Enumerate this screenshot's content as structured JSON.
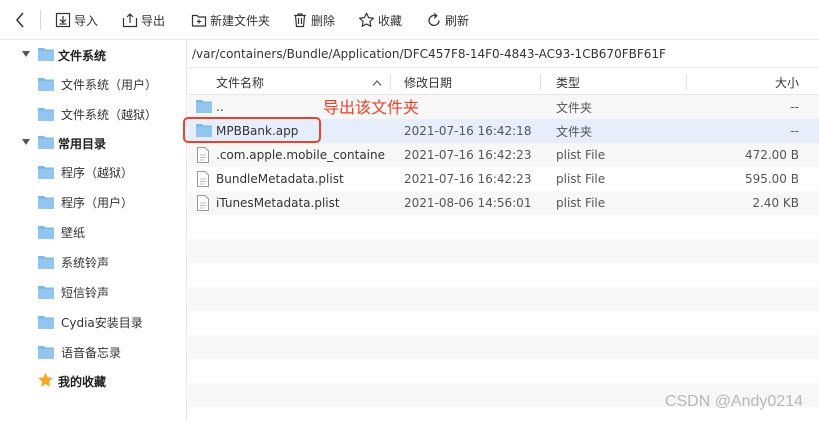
{
  "toolbar": {
    "back_icon": "chevron-left-icon",
    "buttons": [
      {
        "label": "导入",
        "icon": "import-icon"
      },
      {
        "label": "导出",
        "icon": "export-icon"
      },
      {
        "label": "新建文件夹",
        "icon": "new-folder-icon"
      },
      {
        "label": "删除",
        "icon": "trash-icon"
      },
      {
        "label": "收藏",
        "icon": "star-icon"
      },
      {
        "label": "刷新",
        "icon": "refresh-icon"
      }
    ]
  },
  "sidebar": {
    "groups": [
      {
        "label": "文件系统",
        "items": [
          "文件系统（用户）",
          "文件系统（越狱）"
        ]
      },
      {
        "label": "常用目录",
        "items": [
          "程序（越狱）",
          "程序（用户）",
          "壁纸",
          "系统铃声",
          "短信铃声",
          "Cydia安装目录",
          "语音备忘录"
        ]
      }
    ],
    "favorites_label": "我的收藏"
  },
  "path": "/var/containers/Bundle/Application/DFC457F8-14F0-4843-AC93-1CB670FBF61F",
  "table": {
    "columns": {
      "name": "文件名称",
      "date": "修改日期",
      "type": "类型",
      "size": "大小"
    },
    "rows": [
      {
        "name": "..",
        "date": "",
        "type": "文件夹",
        "size": "--",
        "icon": "folder-icon"
      },
      {
        "name": "MPBBank.app",
        "date": "2021-07-16 16:42:18",
        "type": "文件夹",
        "size": "--",
        "icon": "folder-icon"
      },
      {
        "name": ".com.apple.mobile_container...",
        "date": "2021-07-16 16:42:23",
        "type": "plist File",
        "size": "472.00 B",
        "icon": "file-icon"
      },
      {
        "name": "BundleMetadata.plist",
        "date": "2021-07-16 16:42:23",
        "type": "plist File",
        "size": "595.00 B",
        "icon": "file-icon"
      },
      {
        "name": "iTunesMetadata.plist",
        "date": "2021-08-06 14:56:01",
        "type": "plist File",
        "size": "2.40 KB",
        "icon": "file-icon"
      }
    ]
  },
  "annotation": "导出该文件夹",
  "watermark": "CSDN @Andy0214",
  "colors": {
    "accent_folder": "#7cb8e8",
    "annotation": "#e8432b",
    "selected_row": "#e6eefc"
  }
}
